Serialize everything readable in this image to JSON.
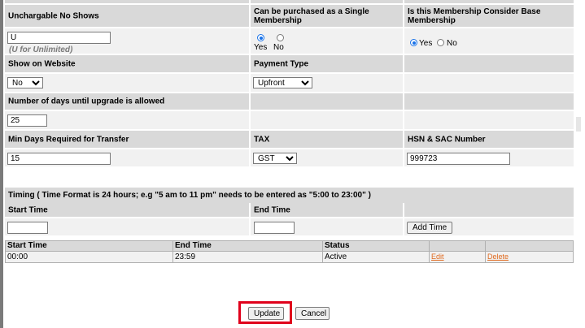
{
  "rows": {
    "r1": {
      "unchargable_label": "Unchargable No Shows",
      "single_label": "Can be purchased as a Single Membership",
      "base_label": "Is this Membership Consider Base Membership"
    },
    "r1v": {
      "unchargable_value": "U",
      "unchargable_hint": "(U for Unlimited)",
      "single_yes": "Yes",
      "single_no": "No",
      "base_yes": "Yes",
      "base_no": "No"
    },
    "r2": {
      "show_label": "Show on Website",
      "payment_label": "Payment Type"
    },
    "r2v": {
      "show_value": "No",
      "payment_value": "Upfront"
    },
    "r3": {
      "days_label": "Number of days until upgrade is allowed"
    },
    "r3v": {
      "days_value": "25"
    },
    "r4": {
      "min_days_label": "Min Days Required for Transfer",
      "tax_label": "TAX",
      "hsn_label": "HSN & SAC Number"
    },
    "r4v": {
      "min_days_value": "15",
      "tax_value": "GST",
      "hsn_value": "999723"
    }
  },
  "timing": {
    "title": "Timing ( Time Format is 24 hours; e.g \"5 am to 11 pm\" needs to be entered as \"5:00 to 23:00\" )",
    "start_label": "Start Time",
    "end_label": "End Time",
    "start_value": "",
    "end_value": "",
    "add_button": "Add Time",
    "table": {
      "headers": [
        "Start Time",
        "End Time",
        "Status",
        "",
        ""
      ],
      "rows": [
        {
          "start": "00:00",
          "end": "23:59",
          "status": "Active",
          "edit": "Edit",
          "delete": "Delete"
        }
      ]
    }
  },
  "actions": {
    "update": "Update",
    "cancel": "Cancel"
  },
  "colors": {
    "header_bg": "#d9d9d9",
    "value_bg": "#f1f1f1",
    "link": "#e06a1e",
    "highlight": "#e0001b",
    "radio": "#1a73e8"
  }
}
